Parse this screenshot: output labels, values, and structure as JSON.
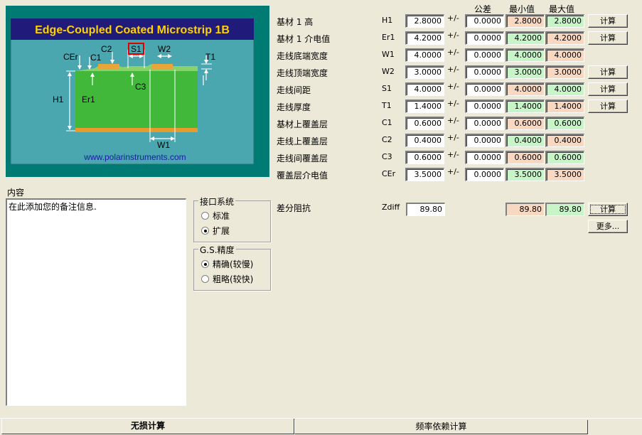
{
  "diagram": {
    "title": "Edge-Coupled Coated Microstrip 1B",
    "url": "www.polarinstruments.com",
    "labels": {
      "cer": "CEr",
      "c1": "C1",
      "c2": "C2",
      "s1": "S1",
      "w2": "W2",
      "t1": "T1",
      "h1": "H1",
      "er1": "Er1",
      "c3": "C3",
      "w1": "W1"
    }
  },
  "headers": {
    "tolerance": "公差",
    "min": "最小值",
    "max": "最大值"
  },
  "rows": [
    {
      "label": "基材 1 高",
      "symbol": "H1",
      "value": "2.8000",
      "pm": "+/-",
      "tol": "0.0000",
      "min": "2.8000",
      "max": "2.8000",
      "button": "计算"
    },
    {
      "label": "基材 1 介电值",
      "symbol": "Er1",
      "value": "4.2000",
      "pm": "+/-",
      "tol": "0.0000",
      "min": "4.2000",
      "max": "4.2000",
      "button": "计算"
    },
    {
      "label": "走线底端宽度",
      "symbol": "W1",
      "value": "4.0000",
      "pm": "+/-",
      "tol": "0.0000",
      "min": "4.0000",
      "max": "4.0000",
      "button": ""
    },
    {
      "label": "走线顶端宽度",
      "symbol": "W2",
      "value": "3.0000",
      "pm": "+/-",
      "tol": "0.0000",
      "min": "3.0000",
      "max": "3.0000",
      "button": "计算"
    },
    {
      "label": "走线间距",
      "symbol": "S1",
      "value": "4.0000",
      "pm": "+/-",
      "tol": "0.0000",
      "min": "4.0000",
      "max": "4.0000",
      "button": "计算"
    },
    {
      "label": "走线厚度",
      "symbol": "T1",
      "value": "1.4000",
      "pm": "+/-",
      "tol": "0.0000",
      "min": "1.4000",
      "max": "1.4000",
      "button": "计算"
    },
    {
      "label": "基材上覆盖层",
      "symbol": "C1",
      "value": "0.6000",
      "pm": "+/-",
      "tol": "0.0000",
      "min": "0.6000",
      "max": "0.6000",
      "button": ""
    },
    {
      "label": "走线上覆盖层",
      "symbol": "C2",
      "value": "0.4000",
      "pm": "+/-",
      "tol": "0.0000",
      "min": "0.4000",
      "max": "0.4000",
      "button": ""
    },
    {
      "label": "走线间覆盖层",
      "symbol": "C3",
      "value": "0.6000",
      "pm": "+/-",
      "tol": "0.0000",
      "min": "0.6000",
      "max": "0.6000",
      "button": ""
    },
    {
      "label": "覆盖层介电值",
      "symbol": "CEr",
      "value": "3.5000",
      "pm": "+/-",
      "tol": "0.0000",
      "min": "3.5000",
      "max": "3.5000",
      "button": ""
    }
  ],
  "impedance": {
    "label": "差分阻抗",
    "symbol": "Zdiff",
    "value": "89.80",
    "min": "89.80",
    "max": "89.80",
    "calc_button": "计算",
    "more_button": "更多..."
  },
  "notes": {
    "label": "内容",
    "text": "在此添加您的备注信息."
  },
  "interface": {
    "title": "接口系统",
    "options": [
      "标准",
      "扩展"
    ],
    "selected": 1
  },
  "precision": {
    "title": "G.S.精度",
    "options": [
      "精确(较慢)",
      "粗略(较快)"
    ],
    "selected": 0
  },
  "tabs": [
    "无损计算",
    "频率依赖计算"
  ],
  "colors": {
    "panel": "#007b74",
    "title_bar": "#201a7a",
    "min_green": "#c8f5c8",
    "peach": "#f9d8c2"
  }
}
